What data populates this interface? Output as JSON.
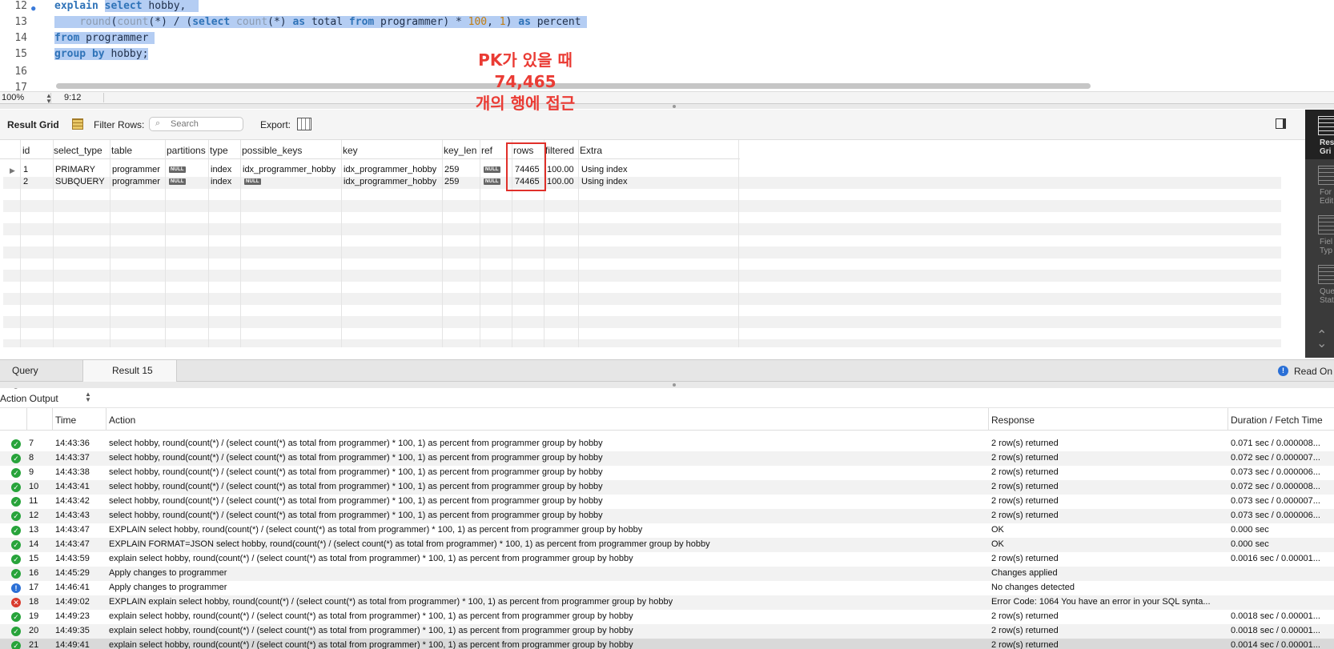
{
  "editor": {
    "lines": [
      {
        "num": "12",
        "dot": true
      },
      {
        "num": "13",
        "dot": false
      },
      {
        "num": "14",
        "dot": false
      },
      {
        "num": "15",
        "dot": false
      },
      {
        "num": "16",
        "dot": false
      },
      {
        "num": "17",
        "dot": false
      }
    ],
    "tokens": {
      "explain": "explain",
      "select": "select",
      "hobby_comma": " hobby,",
      "round": "round",
      "count": "count",
      "star_open": "(*) / (",
      "select2": "select",
      "count2": "count",
      "star2": "(*) ",
      "as": "as",
      "total": " total ",
      "from": "from",
      "programmer_paren": " programmer) * ",
      "hundred": "100",
      "comma_sp": ", ",
      "one": "1",
      "close_paren": ") ",
      "as2": "as",
      "percent": " percent",
      "from2": "from",
      "programmer": " programmer",
      "group_by": "group by",
      "hobby_semi": " hobby;"
    },
    "zoom": "100%",
    "cursor_pos": "9:12"
  },
  "annotation": {
    "line1": "PK가 있을 때",
    "line2": "74,465",
    "line3": "개의 행에 접근"
  },
  "result_toolbar": {
    "title": "Result Grid",
    "filter_label": "Filter Rows:",
    "search_placeholder": "Search",
    "export_label": "Export:"
  },
  "sidebar": {
    "items": [
      {
        "label": "Resu\nGri"
      },
      {
        "label": "For\nEdit"
      },
      {
        "label": "Fiel\nTyp"
      },
      {
        "label": "Que\nStat"
      }
    ]
  },
  "grid": {
    "columns": [
      "id",
      "select_type",
      "table",
      "partitions",
      "type",
      "possible_keys",
      "key",
      "key_len",
      "ref",
      "rows",
      "filtered",
      "Extra"
    ],
    "rows": [
      {
        "id": "1",
        "select_type": "PRIMARY",
        "table": "programmer",
        "partitions": "NULL",
        "type": "index",
        "possible_keys": "idx_programmer_hobby",
        "key": "idx_programmer_hobby",
        "key_len": "259",
        "ref": "NULL",
        "rows": "74465",
        "filtered": "100.00",
        "extra": "Using index"
      },
      {
        "id": "2",
        "select_type": "SUBQUERY",
        "table": "programmer",
        "partitions": "NULL",
        "type": "index",
        "possible_keys": "NULL",
        "key": "idx_programmer_hobby",
        "key_len": "259",
        "ref": "NULL",
        "rows": "74465",
        "filtered": "100.00",
        "extra": "Using index"
      }
    ]
  },
  "tabs": [
    {
      "label": "Query Output"
    },
    {
      "label": "Result 15"
    }
  ],
  "read_only": {
    "icon": "!",
    "label": "Read On"
  },
  "action_output": {
    "selector": "Action Output",
    "columns": [
      "Time",
      "Action",
      "Response",
      "Duration / Fetch Time"
    ],
    "rows": [
      {
        "status": "ok",
        "num": "7",
        "time": "14:43:36",
        "action": "select hobby,      round(count(*) / (select count(*) as total from programmer) * 100, 1) as percent from programmer group by hobby",
        "response": "2 row(s) returned",
        "duration": "0.071 sec / 0.000008..."
      },
      {
        "status": "ok",
        "num": "8",
        "time": "14:43:37",
        "action": "select hobby,      round(count(*) / (select count(*) as total from programmer) * 100, 1) as percent from programmer group by hobby",
        "response": "2 row(s) returned",
        "duration": "0.072 sec / 0.000007..."
      },
      {
        "status": "ok",
        "num": "9",
        "time": "14:43:38",
        "action": "select hobby,      round(count(*) / (select count(*) as total from programmer) * 100, 1) as percent from programmer group by hobby",
        "response": "2 row(s) returned",
        "duration": "0.073 sec / 0.000006..."
      },
      {
        "status": "ok",
        "num": "10",
        "time": "14:43:41",
        "action": "select hobby,      round(count(*) / (select count(*) as total from programmer) * 100, 1) as percent from programmer group by hobby",
        "response": "2 row(s) returned",
        "duration": "0.072 sec / 0.000008..."
      },
      {
        "status": "ok",
        "num": "11",
        "time": "14:43:42",
        "action": "select hobby,      round(count(*) / (select count(*) as total from programmer) * 100, 1) as percent from programmer group by hobby",
        "response": "2 row(s) returned",
        "duration": "0.073 sec / 0.000007..."
      },
      {
        "status": "ok",
        "num": "12",
        "time": "14:43:43",
        "action": "select hobby,      round(count(*) / (select count(*) as total from programmer) * 100, 1) as percent from programmer group by hobby",
        "response": "2 row(s) returned",
        "duration": "0.073 sec / 0.000006..."
      },
      {
        "status": "ok",
        "num": "13",
        "time": "14:43:47",
        "action": "EXPLAIN select hobby,      round(count(*) / (select count(*) as total from programmer) * 100, 1) as percent from programmer group by hobby",
        "response": "OK",
        "duration": "0.000 sec"
      },
      {
        "status": "ok",
        "num": "14",
        "time": "14:43:47",
        "action": "EXPLAIN FORMAT=JSON select hobby,      round(count(*) / (select count(*) as total from programmer) * 100, 1) as percent from programmer group by hobby",
        "response": "OK",
        "duration": "0.000 sec"
      },
      {
        "status": "ok",
        "num": "15",
        "time": "14:43:59",
        "action": "explain select hobby,      round(count(*) / (select count(*) as total from programmer) * 100, 1) as percent from programmer group by hobby",
        "response": "2 row(s) returned",
        "duration": "0.0016 sec / 0.00001..."
      },
      {
        "status": "ok",
        "num": "16",
        "time": "14:45:29",
        "action": "Apply changes to programmer",
        "response": "Changes applied",
        "duration": ""
      },
      {
        "status": "info",
        "num": "17",
        "time": "14:46:41",
        "action": "Apply changes to programmer",
        "response": "No changes detected",
        "duration": ""
      },
      {
        "status": "err",
        "num": "18",
        "time": "14:49:02",
        "action": "EXPLAIN explain select hobby,      round(count(*) / (select count(*) as total from programmer) * 100, 1) as percent from programmer group by hobby",
        "response": "Error Code: 1064 You have an error in your SQL synta...",
        "duration": ""
      },
      {
        "status": "ok",
        "num": "19",
        "time": "14:49:23",
        "action": "explain select hobby,      round(count(*) / (select count(*) as total from programmer) * 100, 1) as percent from programmer group by hobby",
        "response": "2 row(s) returned",
        "duration": "0.0018 sec / 0.00001..."
      },
      {
        "status": "ok",
        "num": "20",
        "time": "14:49:35",
        "action": "explain select hobby,      round(count(*) / (select count(*) as total from programmer) * 100, 1) as percent from programmer group by hobby",
        "response": "2 row(s) returned",
        "duration": "0.0018 sec / 0.00001..."
      },
      {
        "status": "ok",
        "num": "21",
        "time": "14:49:41",
        "action": "explain select hobby,      round(count(*) / (select count(*) as total from programmer) * 100, 1) as percent from programmer group by hobby",
        "response": "2 row(s) returned",
        "duration": "0.0014 sec / 0.00001..."
      }
    ]
  },
  "colors": {
    "annotation_red": "#ea3b34",
    "selection_blue": "#b4cdf3",
    "keyword_blue": "#2f73b8",
    "ok_green": "#27a33a",
    "error_red": "#d93a2c"
  }
}
